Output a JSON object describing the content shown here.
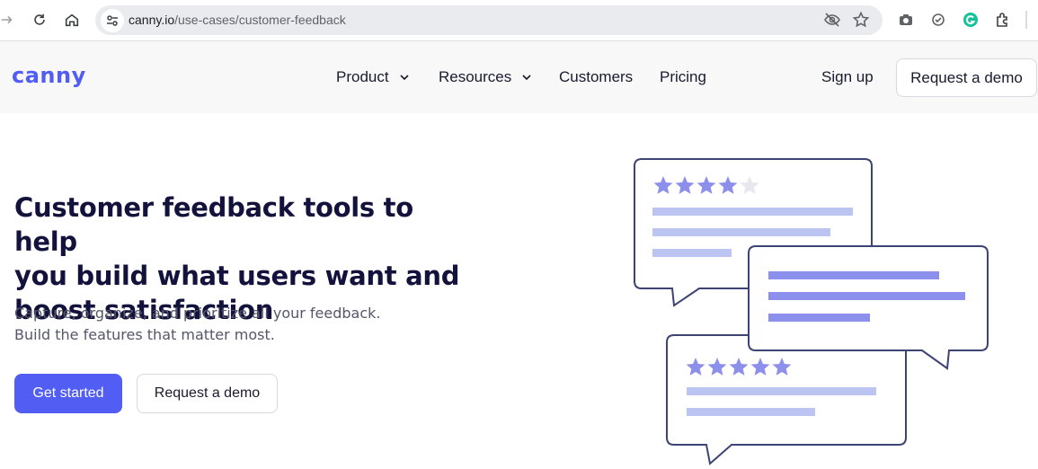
{
  "browser": {
    "url_host": "canny.io",
    "url_path": "/use-cases/customer-feedback"
  },
  "site": {
    "logo": "canny",
    "nav": [
      {
        "label": "Product",
        "has_dropdown": true
      },
      {
        "label": "Resources",
        "has_dropdown": true
      },
      {
        "label": "Customers",
        "has_dropdown": false
      },
      {
        "label": "Pricing",
        "has_dropdown": false
      }
    ],
    "sign_up": "Sign up",
    "request_demo": "Request a demo"
  },
  "hero": {
    "title_lines": [
      "Customer feedback tools to help",
      "you build what users want and",
      "boost satisfaction"
    ],
    "subtitle_lines": [
      "Capture, organize, and prioritize all your feedback.",
      "Build the features that matter most."
    ],
    "primary_button": "Get started",
    "secondary_button": "Request a demo"
  },
  "illustration": {
    "top_card_rating": 4,
    "bottom_card_rating": 5,
    "max_rating": 5
  },
  "colors": {
    "brand": "#525df4",
    "heading": "#13123d",
    "star": "#8c90ec",
    "line_light": "#bcc4f2",
    "line_dark": "#8c90ec",
    "bubble_stroke": "#3d4373"
  }
}
